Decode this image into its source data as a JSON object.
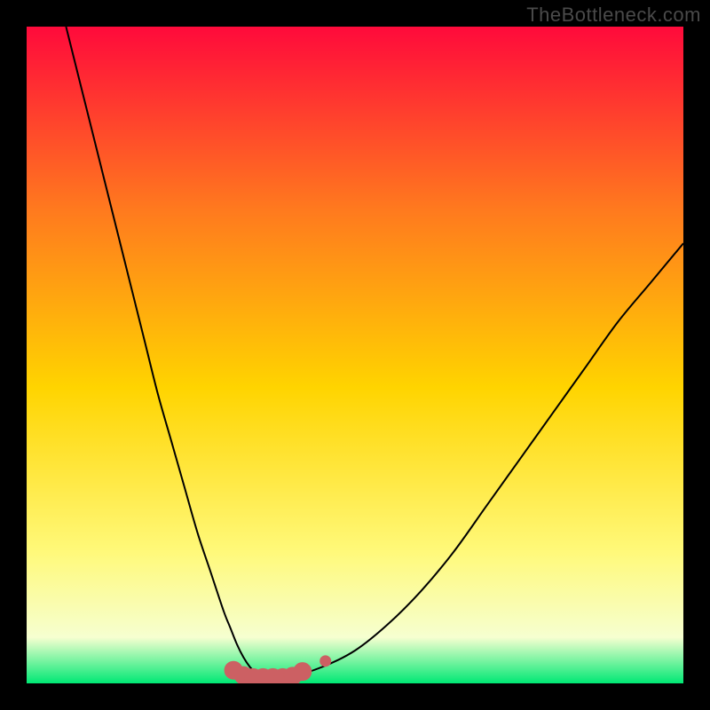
{
  "watermark": "TheBottleneck.com",
  "colors": {
    "frame_bg": "#000000",
    "gradient_top": "#ff0a3b",
    "gradient_mid1": "#ff7a1e",
    "gradient_mid2": "#ffd400",
    "gradient_mid3": "#fff97a",
    "gradient_low": "#f6ffd0",
    "gradient_bottom": "#00e874",
    "curve": "#000000",
    "marker_fill": "#cc6063",
    "marker_stroke": "#cc6063"
  },
  "chart_data": {
    "type": "line",
    "title": "",
    "xlabel": "",
    "ylabel": "",
    "xlim": [
      0,
      100
    ],
    "ylim": [
      0,
      100
    ],
    "grid": false,
    "legend": false,
    "gradient_stops": [
      {
        "offset": 0.0,
        "color_key": "gradient_top"
      },
      {
        "offset": 0.28,
        "color_key": "gradient_mid1"
      },
      {
        "offset": 0.55,
        "color_key": "gradient_mid2"
      },
      {
        "offset": 0.8,
        "color_key": "gradient_mid3"
      },
      {
        "offset": 0.93,
        "color_key": "gradient_low"
      },
      {
        "offset": 1.0,
        "color_key": "gradient_bottom"
      }
    ],
    "series": [
      {
        "name": "bottleneck-curve",
        "x": [
          6,
          8,
          10,
          12,
          14,
          16,
          18,
          20,
          22,
          24,
          26,
          28,
          30,
          31,
          32,
          33,
          34,
          35,
          36,
          40,
          45,
          50,
          55,
          60,
          65,
          70,
          75,
          80,
          85,
          90,
          95,
          100
        ],
        "y": [
          100,
          92,
          84,
          76,
          68,
          60,
          52,
          44,
          37,
          30,
          23,
          17,
          11,
          8.5,
          6,
          4,
          2.5,
          1.5,
          1,
          1,
          2.5,
          5,
          9,
          14,
          20,
          27,
          34,
          41,
          48,
          55,
          61,
          67
        ]
      }
    ],
    "markers": {
      "name": "highlight-markers",
      "points": [
        {
          "x": 31.5,
          "y": 2.0,
          "r": 10
        },
        {
          "x": 33.0,
          "y": 1.2,
          "r": 10
        },
        {
          "x": 34.5,
          "y": 0.9,
          "r": 10
        },
        {
          "x": 36.0,
          "y": 0.9,
          "r": 10
        },
        {
          "x": 37.5,
          "y": 0.9,
          "r": 10
        },
        {
          "x": 39.0,
          "y": 0.9,
          "r": 10
        },
        {
          "x": 40.5,
          "y": 1.1,
          "r": 10
        },
        {
          "x": 42.0,
          "y": 1.8,
          "r": 10
        },
        {
          "x": 45.5,
          "y": 3.4,
          "r": 6
        }
      ]
    }
  }
}
